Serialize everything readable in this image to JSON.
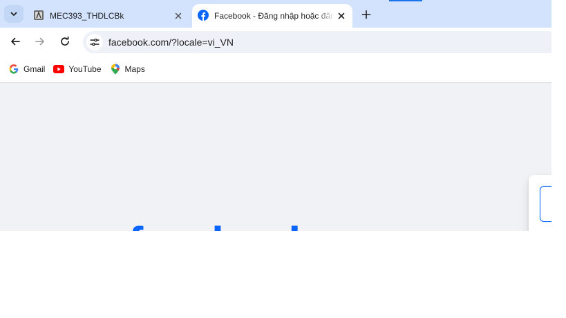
{
  "tabs": [
    {
      "title": "MEC393_THDLCBk",
      "icon": "course-favicon",
      "active": false
    },
    {
      "title": "Facebook - Đăng nhập hoặc đăng ký",
      "icon": "facebook-favicon",
      "active": true
    }
  ],
  "address_bar": {
    "url": "facebook.com/?locale=vi_VN"
  },
  "bookmarks": [
    {
      "label": "Gmail",
      "icon": "google-icon"
    },
    {
      "label": "YouTube",
      "icon": "youtube-icon"
    },
    {
      "label": "Maps",
      "icon": "google-maps-icon"
    }
  ],
  "page": {
    "logo_text": "facebook"
  },
  "colors": {
    "tabstrip": "#d3e3fd",
    "facebook_blue": "#0866ff",
    "page_bg": "#f0f2f5"
  }
}
